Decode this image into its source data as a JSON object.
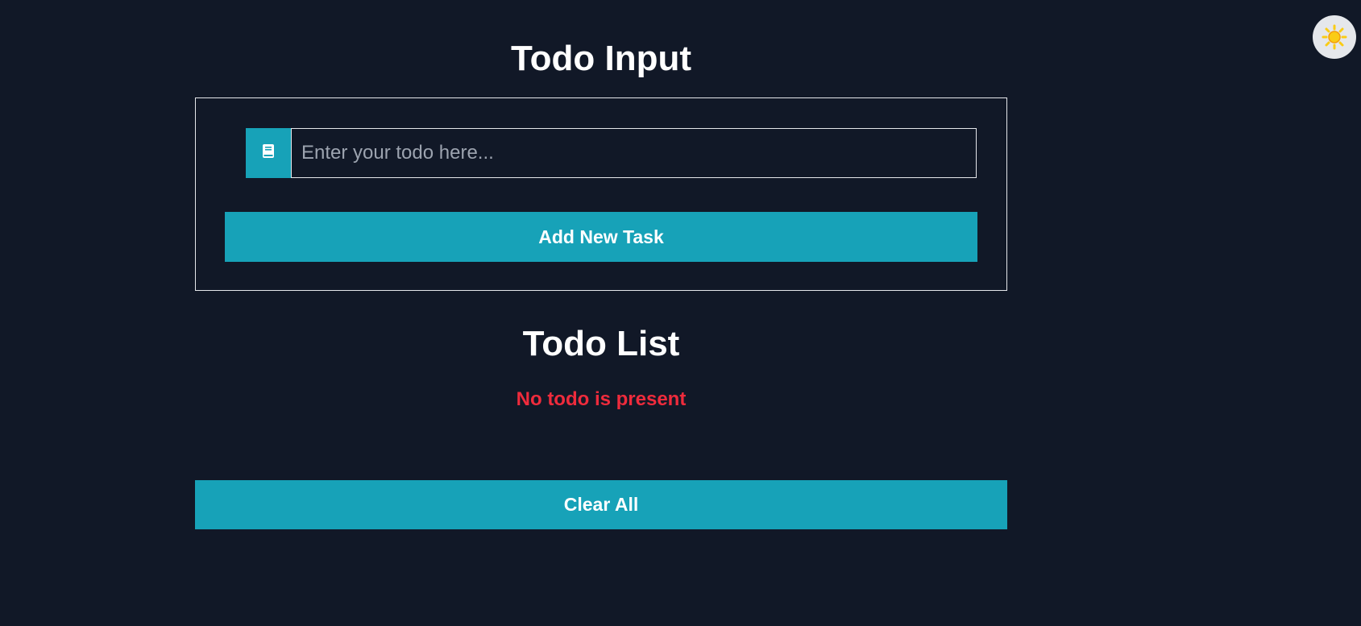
{
  "theme_toggle": {
    "icon": "sun-icon",
    "color": "#facc15"
  },
  "input_section": {
    "title": "Todo Input",
    "input": {
      "icon": "book-icon",
      "placeholder": "Enter your todo here...",
      "value": ""
    },
    "add_button_label": "Add New Task"
  },
  "list_section": {
    "title": "Todo List",
    "empty_message": "No todo is present",
    "clear_button_label": "Clear All"
  },
  "colors": {
    "background": "#111827",
    "accent": "#17a2b8",
    "error": "#ef2b3c",
    "text": "#ffffff"
  }
}
